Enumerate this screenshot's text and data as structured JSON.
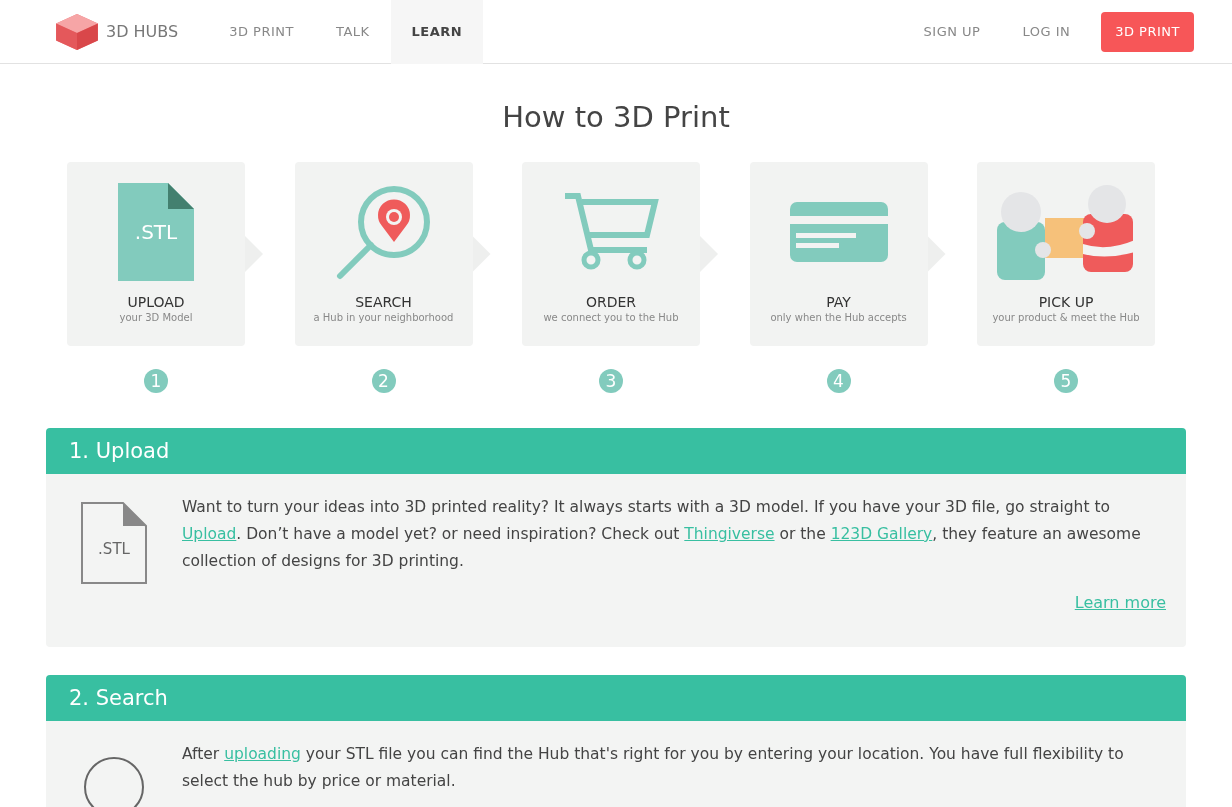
{
  "nav": {
    "brand": "3D HUBS",
    "items": [
      {
        "label": "3D PRINT",
        "selected": false
      },
      {
        "label": "TALK",
        "selected": false
      },
      {
        "label": "LEARN",
        "selected": true
      }
    ],
    "right": [
      "SIGN UP",
      "LOG IN"
    ],
    "cta": "3D PRINT"
  },
  "title": "How to 3D Print",
  "steps": [
    {
      "kind": "file",
      "icon_label": ".STL",
      "title": "UPLOAD",
      "subtitle": "your 3D Model",
      "number": "1"
    },
    {
      "kind": "search",
      "title": "SEARCH",
      "subtitle": "a Hub in your neighborhood",
      "number": "2"
    },
    {
      "kind": "cart",
      "title": "ORDER",
      "subtitle": "we connect you to the Hub",
      "number": "3"
    },
    {
      "kind": "card",
      "title": "PAY",
      "subtitle": "only when the Hub accepts",
      "number": "4"
    },
    {
      "kind": "people",
      "title": "PICK UP",
      "subtitle": "your product & meet the Hub",
      "number": "5"
    }
  ],
  "sections": [
    {
      "title": "1. Upload",
      "kind": "file",
      "icon_label": ".STL",
      "paragraph": [
        {
          "text": "Want to turn your ideas into 3D printed reality? It always starts with a 3D model. If you have your 3D file, go straight to ",
          "link": false
        },
        {
          "text": "Upload",
          "link": true
        },
        {
          "text": ". Don’t have a model yet? or need inspiration? Check out ",
          "link": false
        },
        {
          "text": "Thingiverse",
          "link": true
        },
        {
          "text": " or the ",
          "link": false
        },
        {
          "text": "123D Gallery",
          "link": true
        },
        {
          "text": ", they feature an awesome collection of designs for 3D printing.",
          "link": false
        }
      ],
      "more": "Learn more"
    },
    {
      "title": "2. Search",
      "kind": "circle",
      "paragraph": [
        {
          "text": "After ",
          "link": false
        },
        {
          "text": "uploading",
          "link": true
        },
        {
          "text": " your STL file you can find the Hub that's right for you by entering your location. You have full flexibility to select the hub by price or material.",
          "link": false
        }
      ]
    }
  ]
}
